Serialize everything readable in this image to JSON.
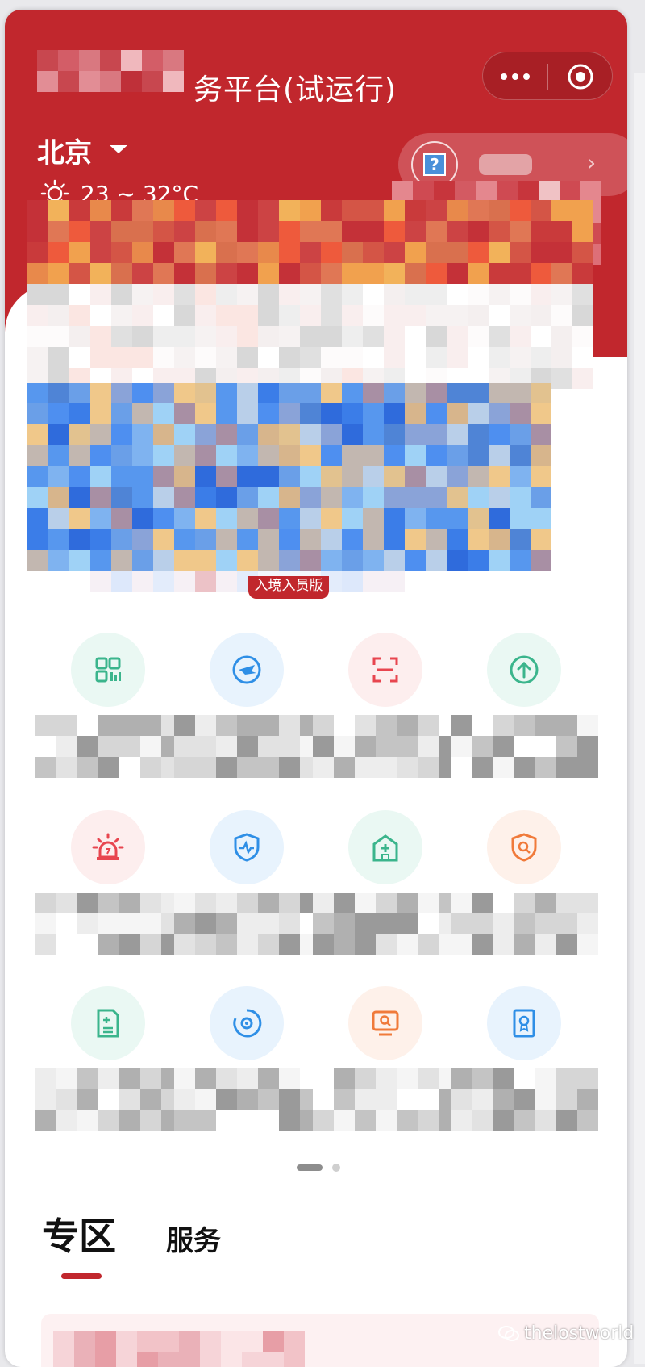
{
  "header": {
    "title_visible": "务平台(试运行)",
    "city": "北京",
    "temperature": "23 ~ 32°C"
  },
  "banner_badge": "入境入员版",
  "colors": {
    "brand_red": "#c1272d",
    "icon_green": "#3bb58c",
    "icon_blue": "#2f8fe6",
    "icon_red": "#e8454f",
    "icon_orange": "#f07a3a"
  },
  "services": [
    {
      "icon": "qr-code-icon",
      "color": "#3bb58c",
      "bg": "#eaf8f3"
    },
    {
      "icon": "airplane-icon",
      "color": "#2f8fe6",
      "bg": "#e8f3fd"
    },
    {
      "icon": "scan-icon",
      "color": "#e8454f",
      "bg": "#fdeeee"
    },
    {
      "icon": "upload-icon",
      "color": "#3bb58c",
      "bg": "#eaf8f3"
    },
    {
      "icon": "alarm-light-icon",
      "color": "#e8454f",
      "bg": "#fdeeee"
    },
    {
      "icon": "shield-pulse-icon",
      "color": "#2f8fe6",
      "bg": "#e8f3fd"
    },
    {
      "icon": "hospital-icon",
      "color": "#3bb58c",
      "bg": "#eaf8f3"
    },
    {
      "icon": "shield-search-icon",
      "color": "#f07a3a",
      "bg": "#fef1ea"
    },
    {
      "icon": "document-add-icon",
      "color": "#3bb58c",
      "bg": "#eaf8f3"
    },
    {
      "icon": "vortex-icon",
      "color": "#2f8fe6",
      "bg": "#e8f3fd"
    },
    {
      "icon": "monitor-search-icon",
      "color": "#f07a3a",
      "bg": "#fef1ea"
    },
    {
      "icon": "certificate-icon",
      "color": "#2f8fe6",
      "bg": "#e8f3fd"
    }
  ],
  "pager": {
    "pages": 2,
    "active": 1
  },
  "tabs": [
    {
      "label": "专区",
      "active": true
    },
    {
      "label": "服务",
      "active": false
    }
  ],
  "watermark": "thelostworld"
}
